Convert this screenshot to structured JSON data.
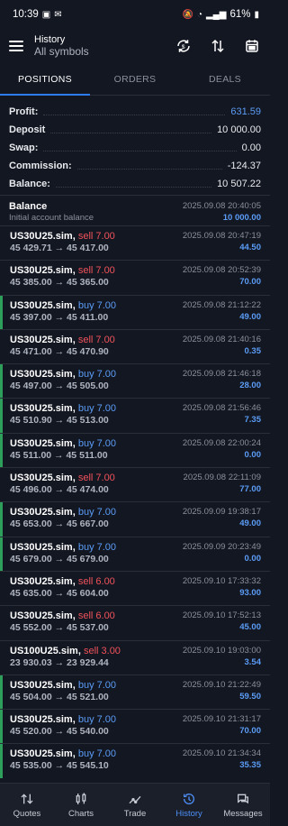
{
  "status": {
    "time": "10:39",
    "battery": "61%"
  },
  "appbar": {
    "title": "History",
    "subtitle": "All symbols"
  },
  "tabs": [
    {
      "label": "POSITIONS",
      "active": true
    },
    {
      "label": "ORDERS",
      "active": false
    },
    {
      "label": "DEALS",
      "active": false
    }
  ],
  "summary": {
    "profit_label": "Profit:",
    "profit": "631.59",
    "deposit_label": "Deposit",
    "deposit": "10 000.00",
    "swap_label": "Swap:",
    "swap": "0.00",
    "commission_label": "Commission:",
    "commission": "-124.37",
    "balance_label": "Balance:",
    "balance": "10 507.22"
  },
  "balance_entry": {
    "name": "Balance",
    "time": "2025.09.08 20:40:05",
    "comment": "Initial account balance",
    "amount": "10 000.00"
  },
  "deals": [
    {
      "symbol": "US30U25.sim,",
      "side": "sell",
      "side_text": "sell 7.00",
      "time": "2025.09.08 20:47:19",
      "prices": "45 429.71 → 45 417.00",
      "profit": "44.50"
    },
    {
      "symbol": "US30U25.sim,",
      "side": "sell",
      "side_text": "sell 7.00",
      "time": "2025.09.08 20:52:39",
      "prices": "45 385.00 → 45 365.00",
      "profit": "70.00"
    },
    {
      "symbol": "US30U25.sim,",
      "side": "buy",
      "side_text": "buy 7.00",
      "time": "2025.09.08 21:12:22",
      "prices": "45 397.00 → 45 411.00",
      "profit": "49.00"
    },
    {
      "symbol": "US30U25.sim,",
      "side": "sell",
      "side_text": "sell 7.00",
      "time": "2025.09.08 21:40:16",
      "prices": "45 471.00 → 45 470.90",
      "profit": "0.35"
    },
    {
      "symbol": "US30U25.sim,",
      "side": "buy",
      "side_text": "buy 7.00",
      "time": "2025.09.08 21:46:18",
      "prices": "45 497.00 → 45 505.00",
      "profit": "28.00"
    },
    {
      "symbol": "US30U25.sim,",
      "side": "buy",
      "side_text": "buy 7.00",
      "time": "2025.09.08 21:56:46",
      "prices": "45 510.90 → 45 513.00",
      "profit": "7.35"
    },
    {
      "symbol": "US30U25.sim,",
      "side": "buy",
      "side_text": "buy 7.00",
      "time": "2025.09.08 22:00:24",
      "prices": "45 511.00 → 45 511.00",
      "profit": "0.00"
    },
    {
      "symbol": "US30U25.sim,",
      "side": "sell",
      "side_text": "sell 7.00",
      "time": "2025.09.08 22:11:09",
      "prices": "45 496.00 → 45 474.00",
      "profit": "77.00"
    },
    {
      "symbol": "US30U25.sim,",
      "side": "buy",
      "side_text": "buy 7.00",
      "time": "2025.09.09 19:38:17",
      "prices": "45 653.00 → 45 667.00",
      "profit": "49.00"
    },
    {
      "symbol": "US30U25.sim,",
      "side": "buy",
      "side_text": "buy 7.00",
      "time": "2025.09.09 20:23:49",
      "prices": "45 679.00 → 45 679.00",
      "profit": "0.00"
    },
    {
      "symbol": "US30U25.sim,",
      "side": "sell",
      "side_text": "sell 6.00",
      "time": "2025.09.10 17:33:32",
      "prices": "45 635.00 → 45 604.00",
      "profit": "93.00"
    },
    {
      "symbol": "US30U25.sim,",
      "side": "sell",
      "side_text": "sell 6.00",
      "time": "2025.09.10 17:52:13",
      "prices": "45 552.00 → 45 537.00",
      "profit": "45.00"
    },
    {
      "symbol": "US100U25.sim,",
      "side": "sell",
      "side_text": "sell 3.00",
      "time": "2025.09.10 19:03:00",
      "prices": "23 930.03 → 23 929.44",
      "profit": "3.54"
    },
    {
      "symbol": "US30U25.sim,",
      "side": "buy",
      "side_text": "buy 7.00",
      "time": "2025.09.10 21:22:49",
      "prices": "45 504.00 → 45 521.00",
      "profit": "59.50"
    },
    {
      "symbol": "US30U25.sim,",
      "side": "buy",
      "side_text": "buy 7.00",
      "time": "2025.09.10 21:31:17",
      "prices": "45 520.00 → 45 540.00",
      "profit": "70.00"
    },
    {
      "symbol": "US30U25.sim,",
      "side": "buy",
      "side_text": "buy 7.00",
      "time": "2025.09.10 21:34:34",
      "prices": "45 535.00 → 45 545.10",
      "profit": "35.35"
    }
  ],
  "nav": [
    {
      "label": "Quotes",
      "icon": "quotes-icon",
      "active": false
    },
    {
      "label": "Charts",
      "icon": "charts-icon",
      "active": false
    },
    {
      "label": "Trade",
      "icon": "trade-icon",
      "active": false
    },
    {
      "label": "History",
      "icon": "history-icon",
      "active": true
    },
    {
      "label": "Messages",
      "icon": "messages-icon",
      "active": false
    }
  ],
  "colors": {
    "accent": "#2e7bf6",
    "buy": "#5b9cf6",
    "sell": "#f0525a",
    "buy_bar": "#2e9f5b"
  }
}
